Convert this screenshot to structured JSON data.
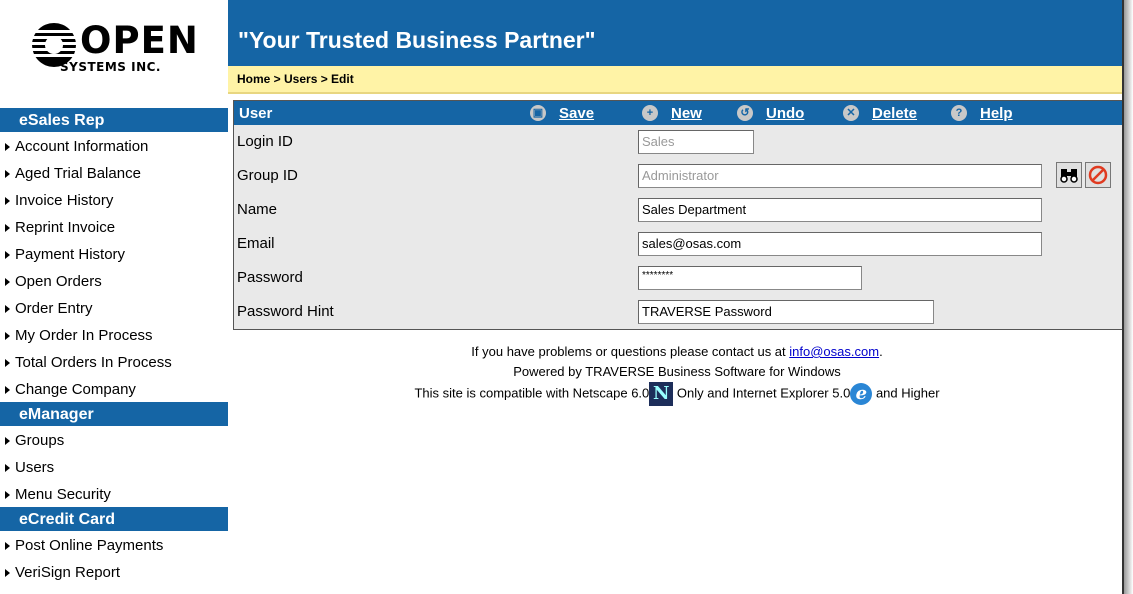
{
  "logo": {
    "word": "OPEN",
    "sub": "SYSTEMS INC."
  },
  "header": {
    "tagline": "\"Your Trusted Business Partner\""
  },
  "breadcrumb": "Home > Users > Edit",
  "sidebar": {
    "sections": [
      {
        "title": "eSales Rep",
        "items": [
          "Account Information",
          "Aged Trial Balance",
          "Invoice History",
          "Reprint Invoice",
          "Payment History",
          "Open Orders",
          "Order Entry",
          "My Order In Process",
          "Total Orders In Process",
          "Change Company"
        ]
      },
      {
        "title": "eManager",
        "items": [
          "Groups",
          "Users",
          "Menu Security"
        ]
      },
      {
        "title": "eCredit Card",
        "items": [
          "Post Online Payments",
          "VeriSign Report"
        ]
      }
    ]
  },
  "form": {
    "title": "User",
    "toolbar": {
      "save": "Save",
      "new": "New",
      "undo": "Undo",
      "delete": "Delete",
      "help": "Help"
    },
    "fields": {
      "login_id": {
        "label": "Login ID",
        "value": "Sales"
      },
      "group_id": {
        "label": "Group ID",
        "value": "Administrator"
      },
      "name": {
        "label": "Name",
        "value": "Sales Department"
      },
      "email": {
        "label": "Email",
        "value": "sales@osas.com"
      },
      "password": {
        "label": "Password",
        "value": "********"
      },
      "password_hint": {
        "label": "Password Hint",
        "value": "TRAVERSE Password"
      }
    }
  },
  "footer": {
    "contact_pre": "If you have problems or questions please contact us at ",
    "contact_link": "info@osas.com",
    "contact_post": ".",
    "powered": "Powered by TRAVERSE Business Software for Windows",
    "compat_pre": "This site is compatible with Netscape 6.0",
    "compat_mid": " Only and Internet Explorer 5.0",
    "compat_post": " and Higher",
    "netscape_glyph": "N",
    "ie_glyph": "e"
  },
  "colors": {
    "accent": "#1565a5",
    "breadcrumb_bg": "#fff3a6",
    "form_bg": "#e9e9e9"
  }
}
